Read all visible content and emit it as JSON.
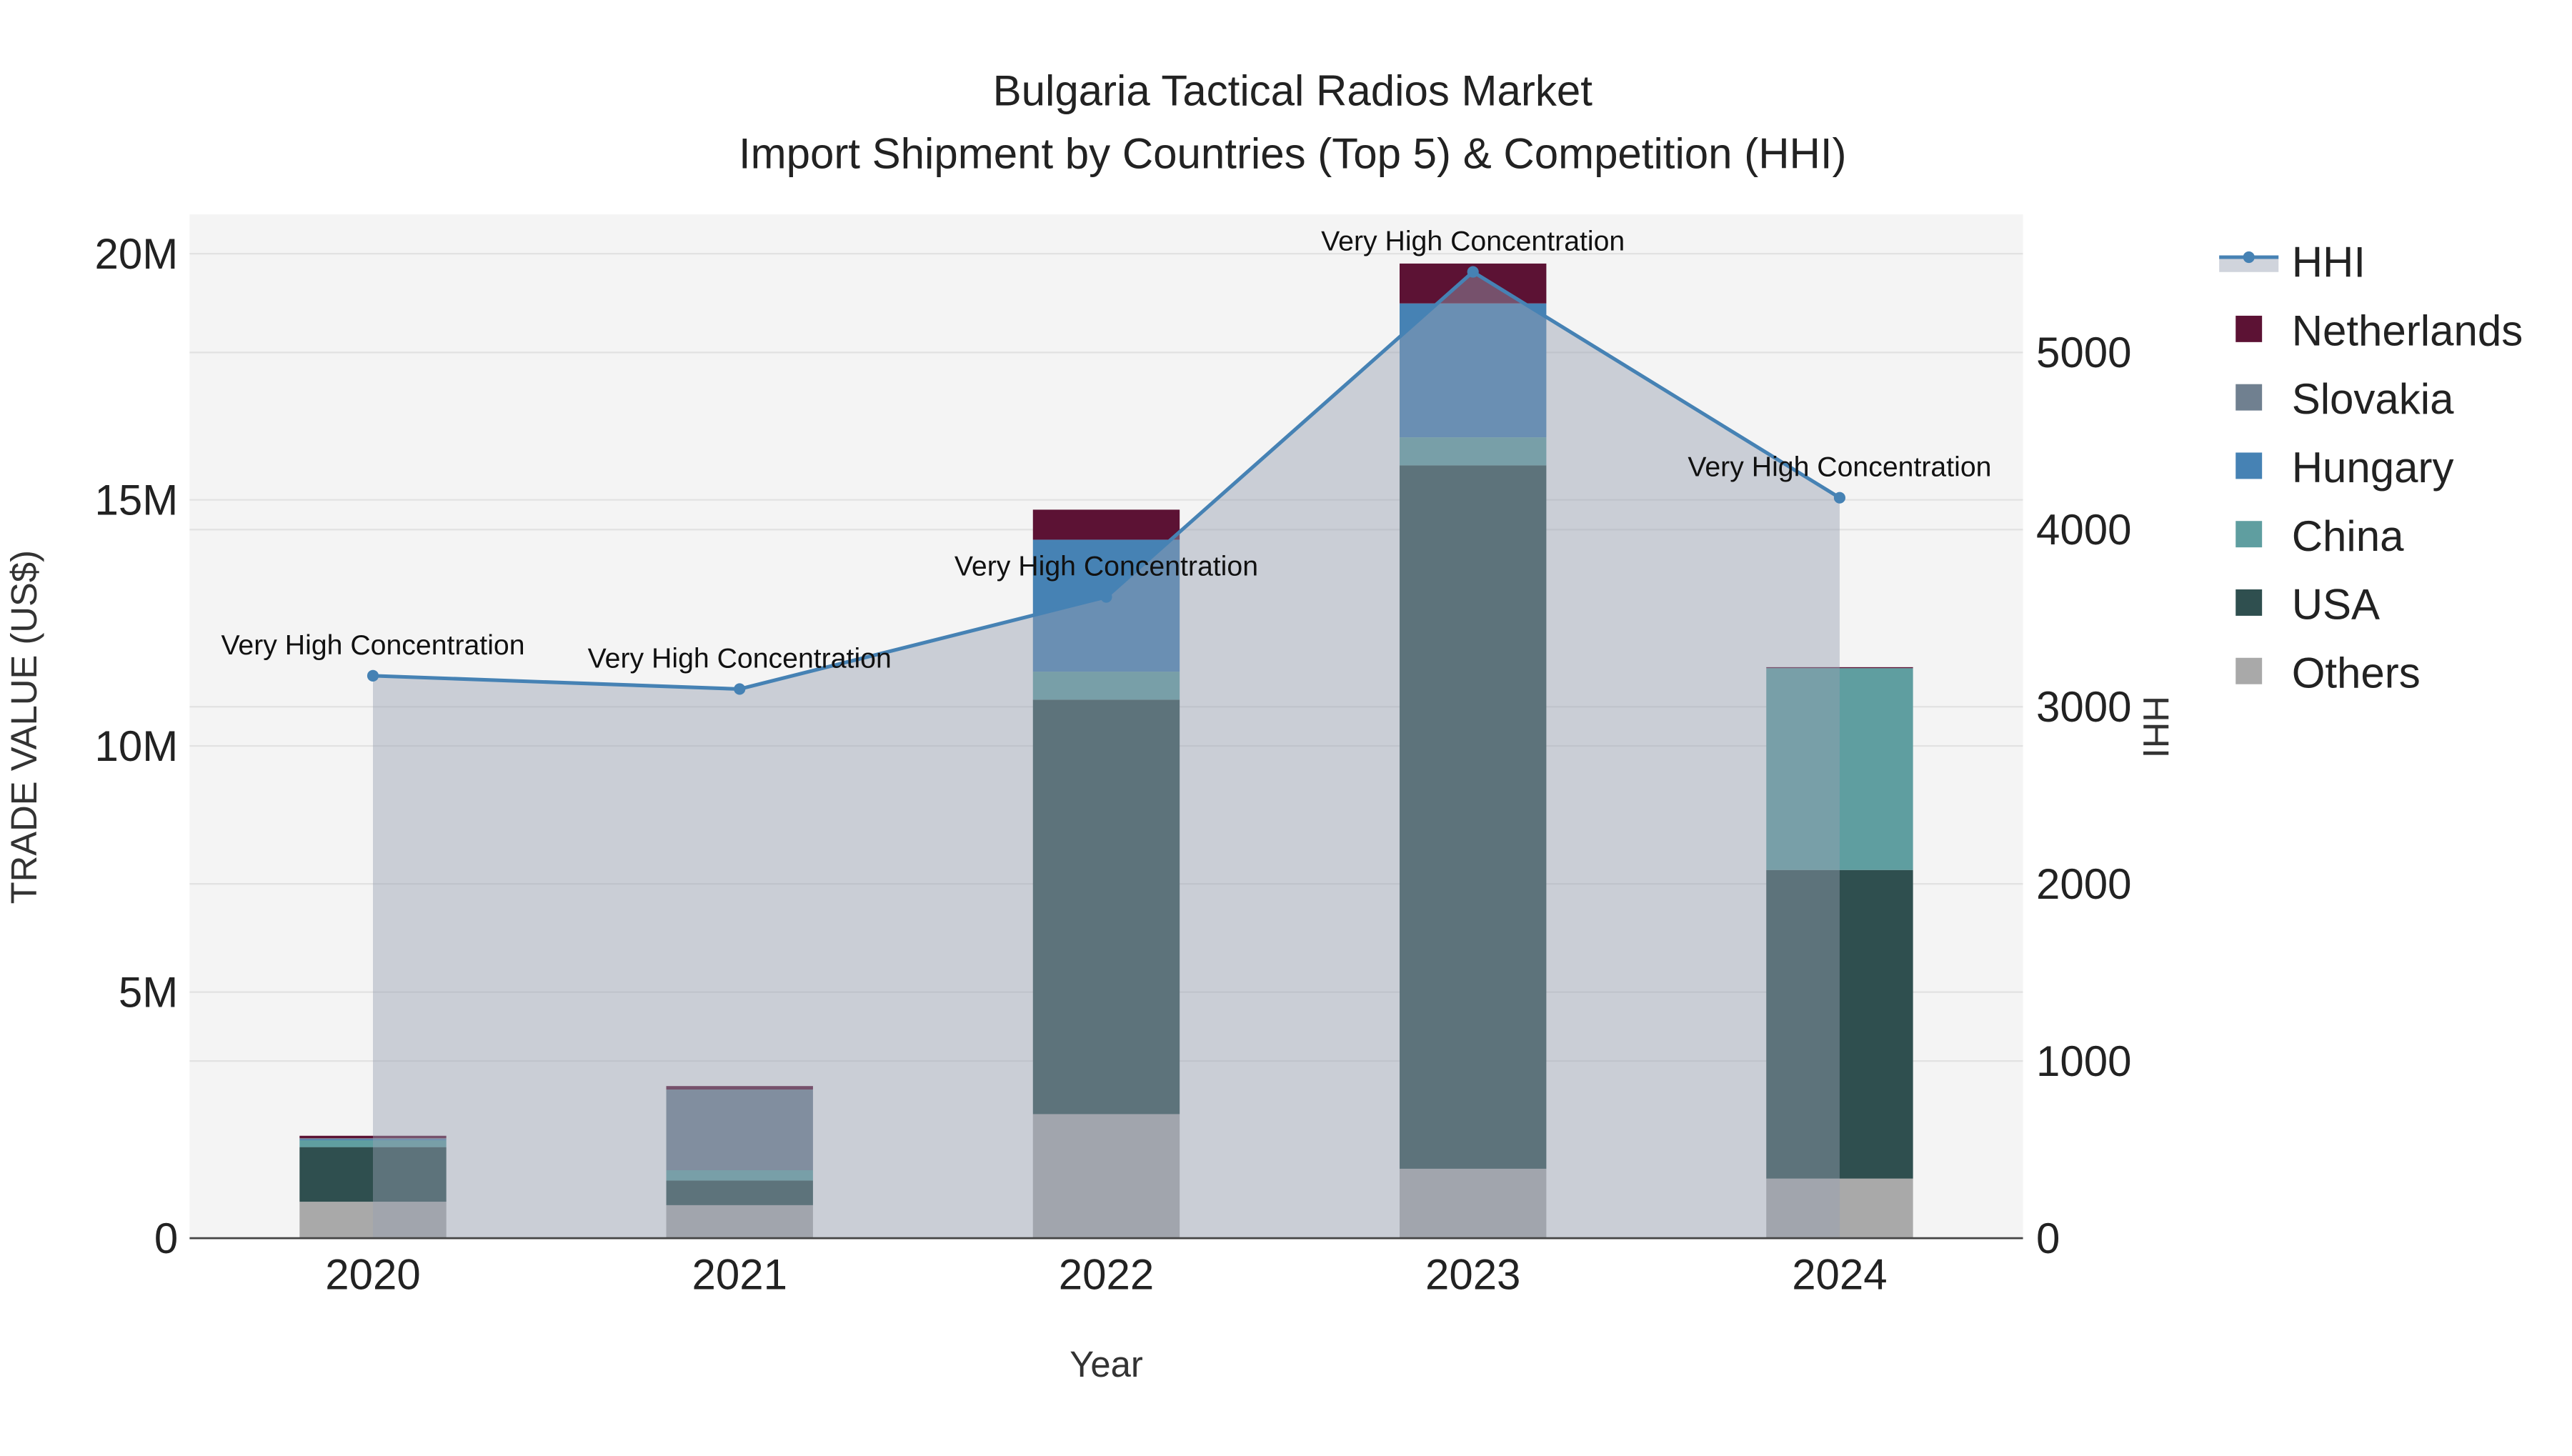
{
  "chart_data": {
    "type": "bar",
    "title_line1": "Bulgaria Tactical Radios Market",
    "title_line2": "Import Shipment by Countries (Top 5) & Competition (HHI)",
    "xlabel": "Year",
    "ylabel": "TRADE VALUE (US$)",
    "y2label": "HHI",
    "categories": [
      "2020",
      "2021",
      "2022",
      "2023",
      "2024"
    ],
    "ylim": [
      0,
      20800000
    ],
    "y2lim": [
      0,
      5780
    ],
    "yticks": [
      0,
      5000000,
      10000000,
      15000000,
      20000000
    ],
    "ytick_labels": [
      "0",
      "5M",
      "10M",
      "15M",
      "20M"
    ],
    "y2ticks": [
      0,
      1000,
      2000,
      3000,
      4000,
      5000
    ],
    "y2tick_labels": [
      "0",
      "1000",
      "2000",
      "3000",
      "4000",
      "5000"
    ],
    "series": [
      {
        "name": "Others",
        "color": "#a9a9a9",
        "values": [
          740000,
          670000,
          2520000,
          1410000,
          1210000
        ]
      },
      {
        "name": "USA",
        "color": "#2f4f4f",
        "values": [
          1110000,
          500000,
          8420000,
          14290000,
          6270000
        ]
      },
      {
        "name": "China",
        "color": "#5f9ea0",
        "values": [
          140000,
          210000,
          570000,
          570000,
          4100000
        ]
      },
      {
        "name": "Hungary",
        "color": "#4682b4",
        "values": [
          20000,
          0,
          2680000,
          2720000,
          0
        ]
      },
      {
        "name": "Slovakia",
        "color": "#708090",
        "values": [
          20000,
          1640000,
          0,
          0,
          0
        ]
      },
      {
        "name": "Netherlands",
        "color": "#5c1234",
        "values": [
          50000,
          70000,
          610000,
          810000,
          20000
        ]
      }
    ],
    "hhi": {
      "name": "HHI",
      "color": "#4682b4",
      "values": [
        3175,
        3100,
        3620,
        5455,
        4180
      ],
      "annotations": [
        "Very High Concentration",
        "Very High Concentration",
        "Very High Concentration",
        "Very High Concentration",
        "Very High Concentration"
      ]
    },
    "legend_order": [
      "HHI",
      "Netherlands",
      "Slovakia",
      "Hungary",
      "China",
      "USA",
      "Others"
    ],
    "legend_placement": "right",
    "grid": true
  }
}
